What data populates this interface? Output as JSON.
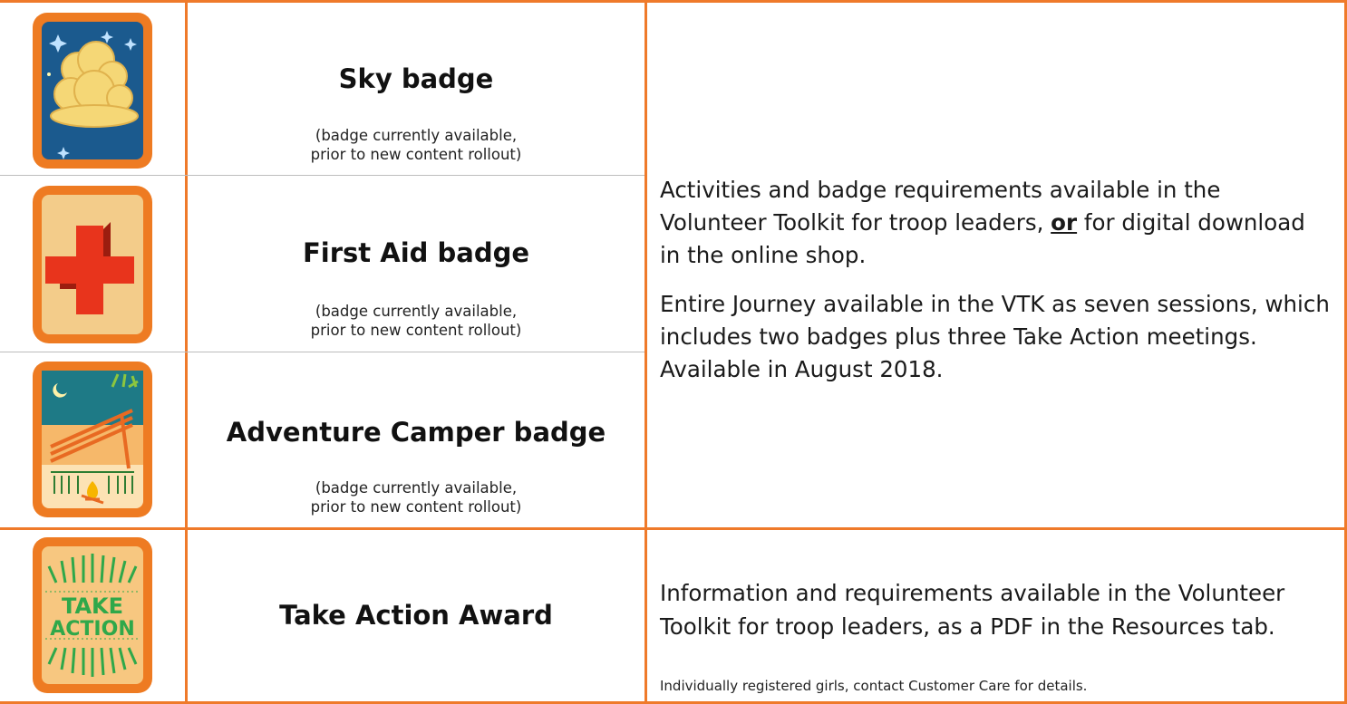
{
  "badges": [
    {
      "name": "Sky badge",
      "note_line1": "(badge currently available,",
      "note_line2": "prior to new content rollout)",
      "icon": "sky-badge-icon"
    },
    {
      "name": "First Aid badge",
      "note_line1": "(badge currently available,",
      "note_line2": "prior to new content rollout)",
      "icon": "first-aid-badge-icon"
    },
    {
      "name": "Adventure Camper badge",
      "note_line1": "(badge currently available,",
      "note_line2": "prior to new content rollout)",
      "icon": "adventure-camper-badge-icon"
    },
    {
      "name": "Take Action Award",
      "icon": "take-action-award-icon"
    }
  ],
  "take_action_icon_text": {
    "line1": "TAKE",
    "line2": "ACTION"
  },
  "right_top": {
    "p1_before": "Activities and badge requirements available in the Volunteer Toolkit for troop leaders, ",
    "p1_emph": "or",
    "p1_after": " for digital download in the online shop.",
    "p2": "Entire Journey available in the VTK as seven sessions, which includes two badges plus three Take Action meetings. Available in August 2018."
  },
  "right_bottom": {
    "p1": "Information and requirements available in the Volunteer Toolkit for troop leaders, as a PDF in the Resources tab.",
    "small": "Individually registered girls, contact Customer Care for details."
  },
  "colors": {
    "border": "#ef7a2a",
    "badge_orange": "#ee7b22",
    "sky_blue": "#1b5a8e",
    "tan": "#f3cc8a",
    "red_cross": "#e8341c",
    "take_action_green": "#2fa84a"
  }
}
